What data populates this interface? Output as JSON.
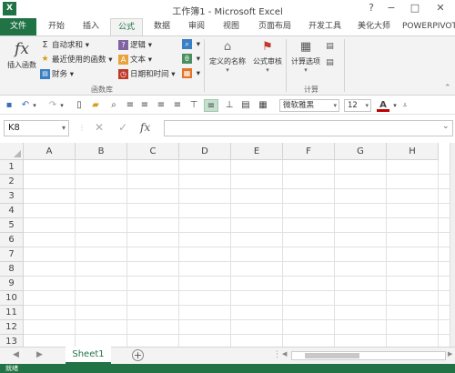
{
  "window": {
    "app_icon": "X",
    "title": "工作簿1 - Microsoft Excel",
    "help": "?",
    "minimize": "−",
    "restore": "□",
    "close": "✕"
  },
  "quick_access": {
    "save": "▪",
    "undo": "↶",
    "redo": "↷",
    "more": "▾"
  },
  "tabs": [
    {
      "label": "文件"
    },
    {
      "label": "开始"
    },
    {
      "label": "插入"
    },
    {
      "label": "公式"
    },
    {
      "label": "数据"
    },
    {
      "label": "审阅"
    },
    {
      "label": "视图"
    },
    {
      "label": "页面布局"
    },
    {
      "label": "开发工具"
    },
    {
      "label": "美化大师"
    },
    {
      "label": "POWERPIVOT"
    }
  ],
  "active_tab": "公式",
  "ribbon": {
    "insert_function": "插入函数",
    "autosum": "自动求和",
    "recent": "最近使用的函数",
    "financial": "财务",
    "logical": "逻辑",
    "text": "文本",
    "datetime": "日期和时间",
    "group_library": "函数库",
    "defined_names": "定义的名称",
    "formula_auditing": "公式审核",
    "calc_options": "计算选项",
    "group_calc": "计算"
  },
  "format_bar": {
    "font_name": "微软雅黑",
    "font_size": "12"
  },
  "formula_bar": {
    "name_box": "K8",
    "cancel": "✕",
    "enter": "✓",
    "fx": "fx",
    "formula": ""
  },
  "grid": {
    "columns": [
      "A",
      "B",
      "C",
      "D",
      "E",
      "F",
      "G",
      "H"
    ],
    "rows": [
      "1",
      "2",
      "3",
      "4",
      "5",
      "6",
      "7",
      "8",
      "9",
      "10",
      "11",
      "12",
      "13"
    ]
  },
  "sheets": {
    "tabs": [
      {
        "label": "Sheet1"
      }
    ],
    "add": "+",
    "prev": "◀",
    "next": "▶"
  },
  "status": {
    "text": "就绪"
  },
  "colors": {
    "accent": "#217346",
    "ribbon_bg": "#f3f3f3",
    "grid_line": "#e1e1e1"
  }
}
